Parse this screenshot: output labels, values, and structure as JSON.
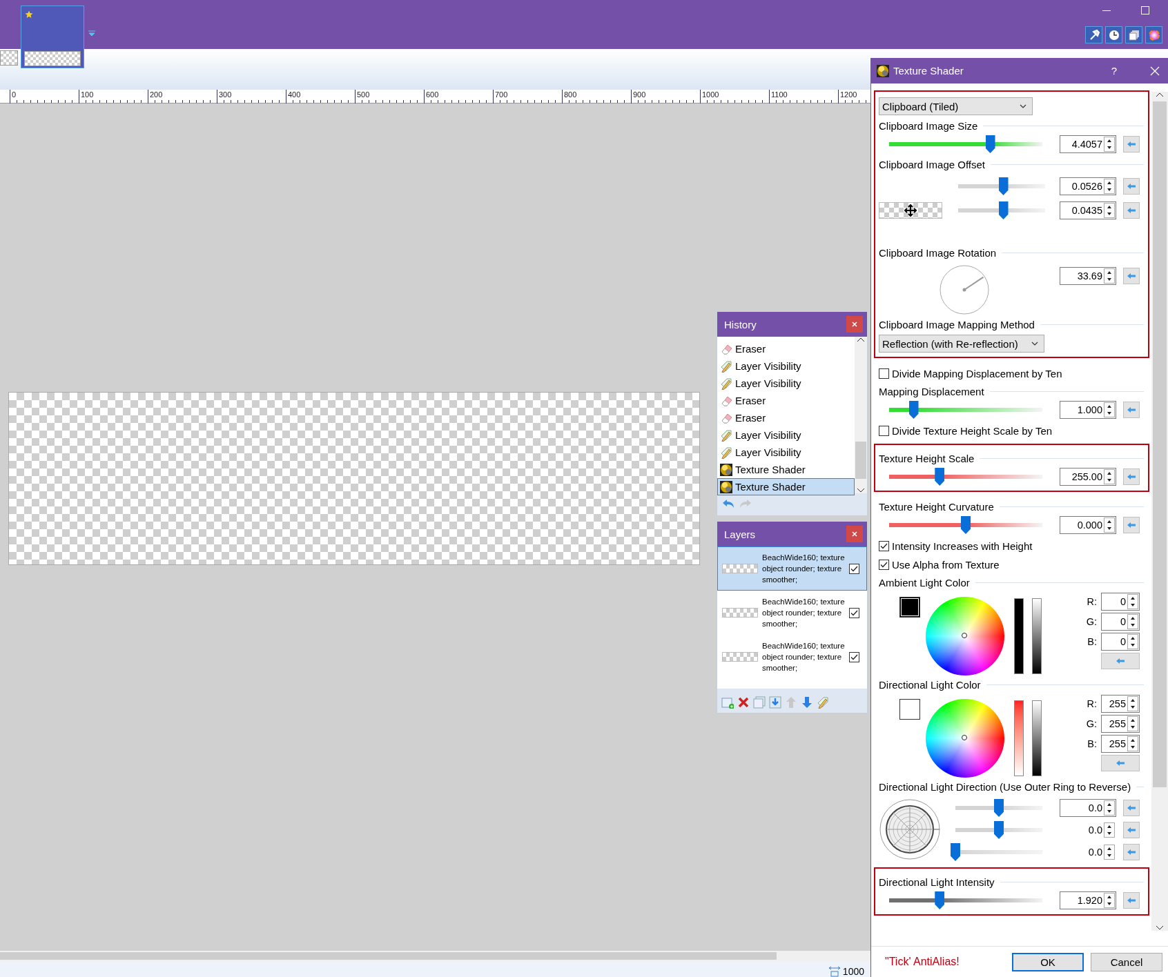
{
  "image_tabs": [
    {
      "kind": "partial",
      "selected": false,
      "modified": false
    },
    {
      "kind": "full",
      "selected": true,
      "modified": true
    }
  ],
  "ruler": {
    "labels": [
      "0",
      "100",
      "200",
      "300",
      "400",
      "500",
      "600",
      "700",
      "800",
      "900",
      "1000",
      "1100",
      "1200"
    ]
  },
  "history": {
    "title": "History",
    "items": [
      {
        "kind": "eraser",
        "label": "Eraser",
        "selected": false
      },
      {
        "kind": "visibility",
        "label": "Layer Visibility",
        "selected": false
      },
      {
        "kind": "visibility",
        "label": "Layer Visibility",
        "selected": false
      },
      {
        "kind": "eraser",
        "label": "Eraser",
        "selected": false
      },
      {
        "kind": "eraser",
        "label": "Eraser",
        "selected": false
      },
      {
        "kind": "visibility",
        "label": "Layer Visibility",
        "selected": false
      },
      {
        "kind": "visibility",
        "label": "Layer Visibility",
        "selected": false
      },
      {
        "kind": "shader",
        "label": "Texture Shader",
        "selected": false
      },
      {
        "kind": "shader",
        "label": "Texture Shader",
        "selected": true
      }
    ]
  },
  "layers": {
    "title": "Layers",
    "items": [
      {
        "label": "BeachWide160; texture object rounder; texture smoother;",
        "visible": true,
        "selected": true
      },
      {
        "label": "BeachWide160; texture object rounder; texture smoother;",
        "visible": true,
        "selected": false
      },
      {
        "label": "BeachWide160; texture object rounder; texture smoother;",
        "visible": true,
        "selected": false
      }
    ]
  },
  "dialog": {
    "title": "Texture Shader",
    "help": "?",
    "sections": [
      {
        "highlighted": true,
        "items": [
          {
            "kind": "dropdown",
            "value": "Clipboard (Tiled)"
          },
          {
            "kind": "slider",
            "label": "Clipboard Image Size",
            "level": 0.66,
            "value": "4.4057",
            "color": "#33dd33"
          },
          {
            "kind": "offset",
            "label": "Clipboard Image Offset",
            "sliders": [
              {
                "level": 0.52,
                "value": "0.0526"
              },
              {
                "level": 0.52,
                "value": "0.0435"
              }
            ]
          },
          {
            "kind": "angle",
            "label": "Clipboard Image Rotation",
            "value": "33.69"
          },
          {
            "kind": "dropdown",
            "label": "Clipboard Image Mapping Method",
            "value": "Reflection (with Re-reflection)"
          }
        ]
      },
      {
        "highlighted": false,
        "items": [
          {
            "kind": "checkbox",
            "label": "Divide Mapping Displacement by Ten",
            "checked": false
          },
          {
            "kind": "slider",
            "label": "Mapping Displacement",
            "level": 0.16,
            "value": "1.000",
            "color": "#33dd33"
          },
          {
            "kind": "checkbox",
            "label": "Divide Texture Height Scale by Ten",
            "checked": false
          }
        ]
      },
      {
        "highlighted": true,
        "items": [
          {
            "kind": "slider",
            "label": "Texture Height Scale",
            "level": 0.33,
            "value": "255.00",
            "color": "#f06060"
          }
        ]
      },
      {
        "highlighted": false,
        "items": [
          {
            "kind": "slider",
            "label": "Texture Height Curvature",
            "level": 0.5,
            "value": "0.000",
            "color": "#f06060"
          },
          {
            "kind": "checkbox",
            "label": "Intensity Increases with Height",
            "checked": true
          },
          {
            "kind": "checkbox",
            "label": "Use Alpha from Texture",
            "checked": true
          },
          {
            "kind": "color",
            "label": "Ambient Light Color",
            "color": "#000000",
            "channels": [
              {
                "label": "R:",
                "value": "0"
              },
              {
                "label": "G:",
                "value": "0"
              },
              {
                "label": "B:",
                "value": "0"
              }
            ]
          },
          {
            "kind": "color",
            "label": "Directional Light Color",
            "color": "#ffffff",
            "channels": [
              {
                "label": "R:",
                "value": "255"
              },
              {
                "label": "G:",
                "value": "255"
              },
              {
                "label": "B:",
                "value": "255"
              }
            ]
          },
          {
            "kind": "direction",
            "label": "Directional Light Direction (Use Outer Ring to Reverse)",
            "sliders": [
              {
                "level": 0.5,
                "value": "0.0"
              },
              {
                "level": 0.5,
                "value": "0.0"
              },
              {
                "level": 0.0,
                "value": "0.0"
              }
            ]
          }
        ]
      },
      {
        "highlighted": true,
        "items": [
          {
            "kind": "slider",
            "label": "Directional Light Intensity",
            "level": 0.33,
            "value": "1.920",
            "color": "#707070"
          }
        ]
      }
    ],
    "note": "\"Tick' AntiAlias!",
    "buttons": [
      {
        "label": "OK",
        "default": true
      },
      {
        "label": "Cancel",
        "default": false
      }
    ]
  },
  "status": {
    "zoom": "1000"
  }
}
